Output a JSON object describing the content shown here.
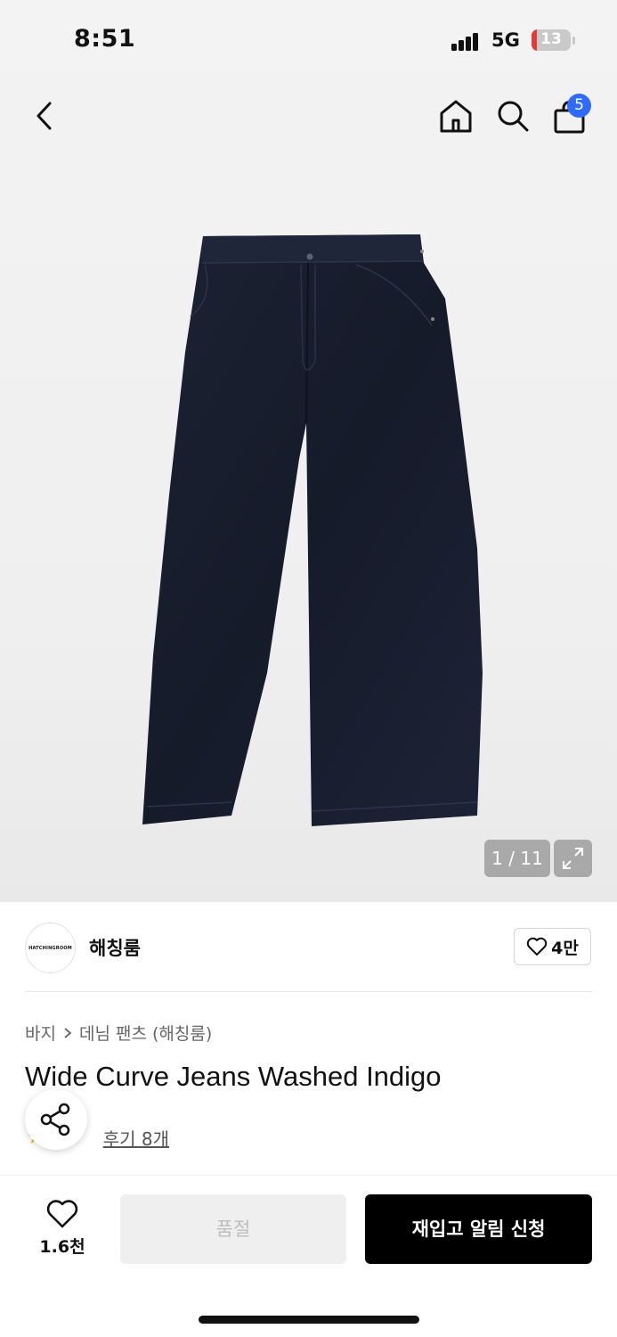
{
  "status_bar": {
    "time": "8:51",
    "network": "5G",
    "battery": "13",
    "battery_color": "#e53935"
  },
  "nav": {
    "back_icon": "chevron-left-icon",
    "home_icon": "home-icon",
    "search_icon": "search-icon",
    "cart_icon": "shopping-bag-icon",
    "cart_count": "5",
    "badge_color": "#2f6bff"
  },
  "gallery": {
    "counter": "1 / 11",
    "expand_icon": "expand-icon"
  },
  "brand": {
    "logo_text": "HATCHINGROOM",
    "name": "해칭룸",
    "like_count": "4만"
  },
  "product": {
    "breadcrumb": [
      "바지",
      "데님 팬츠 (해칭룸)"
    ],
    "title": "Wide Curve Jeans Washed Indigo",
    "review_link": "후기 8개"
  },
  "bottom_bar": {
    "wish_count": "1.6천",
    "soldout_label": "품절",
    "restock_label": "재입고 알림 신청"
  }
}
